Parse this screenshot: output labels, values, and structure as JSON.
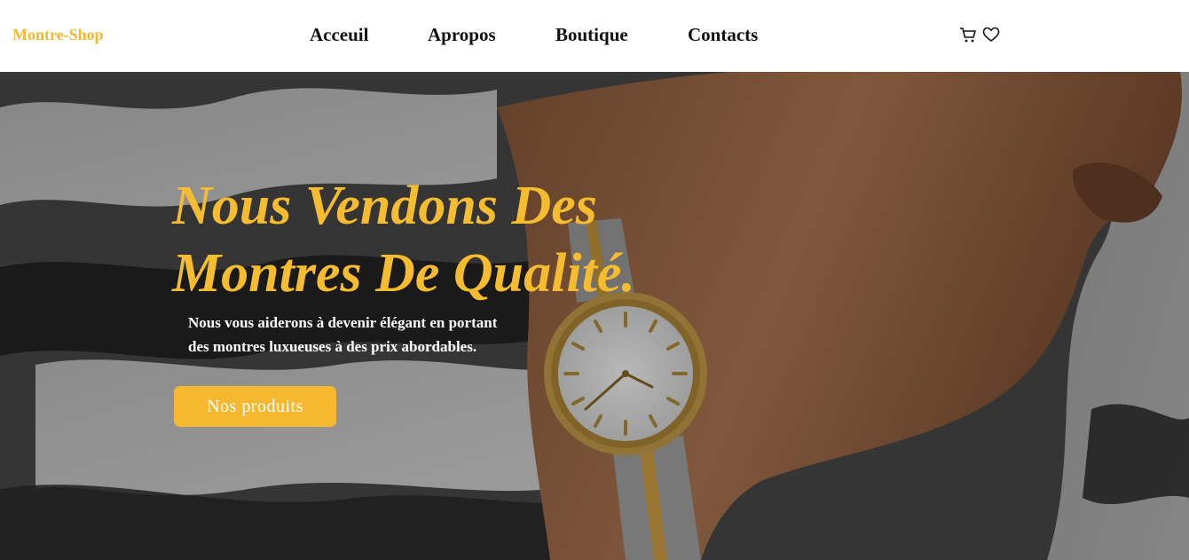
{
  "brand": {
    "name": "Montre-Shop",
    "color": "#f5b82e"
  },
  "nav": {
    "items": [
      {
        "label": "Acceuil"
      },
      {
        "label": "Apropos"
      },
      {
        "label": "Boutique"
      },
      {
        "label": "Contacts"
      }
    ]
  },
  "header_icons": [
    "cart-icon",
    "heart-icon"
  ],
  "hero": {
    "title_line1": "Nous Vendons Des",
    "title_line2": "Montres De Qualité.",
    "subtitle_line1": "Nous vous aiderons à devenir élégant en portant",
    "subtitle_line2": "des montres luxueuses à des prix abordables.",
    "button_label": "Nos produits",
    "accent_color": "#f6bc2f"
  }
}
